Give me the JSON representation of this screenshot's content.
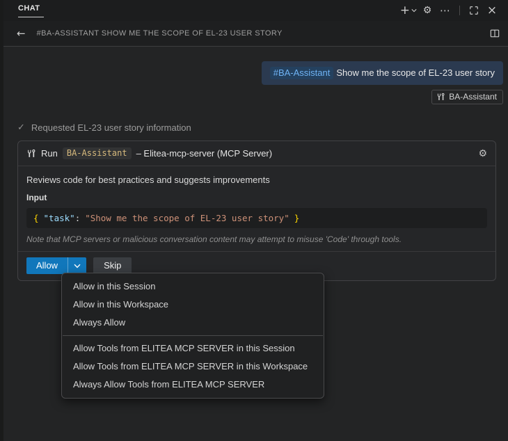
{
  "icons": {
    "plus": "+",
    "gear": "⚙",
    "more": "⋯",
    "close": "×",
    "back": "←",
    "check": "✓"
  },
  "titlebar": {
    "tab_label": "CHAT"
  },
  "breadcrumb": {
    "title": "#BA-ASSISTANT SHOW ME THE SCOPE OF EL-23 USER STORY"
  },
  "chat": {
    "user_message": {
      "mention": "#BA-Assistant",
      "text": "Show me the scope of EL-23 user story"
    },
    "agent_badge": {
      "label": "BA-Assistant"
    },
    "status": {
      "text": "Requested EL-23 user story information"
    }
  },
  "tool_card": {
    "header": {
      "run_label": "Run",
      "tool_name": "BA-Assistant",
      "server_label": "– Elitea-mcp-server (MCP Server)"
    },
    "description": "Reviews code for best practices and suggests improvements",
    "input_label": "Input",
    "code": {
      "open_brace": "{",
      "key": "\"task\"",
      "colon": ":",
      "value": "\"Show me the scope of EL-23 user story\"",
      "close_brace": "}"
    },
    "note": "Note that MCP servers or malicious conversation content may attempt to misuse 'Code' through tools.",
    "actions": {
      "allow": "Allow",
      "skip": "Skip"
    }
  },
  "dropdown": {
    "groups": [
      [
        "Allow in this Session",
        "Allow in this Workspace",
        "Always Allow"
      ],
      [
        "Allow Tools from ELITEA MCP SERVER in this Session",
        "Allow Tools from ELITEA MCP SERVER in this Workspace",
        "Always Allow Tools from ELITEA MCP SERVER"
      ]
    ]
  },
  "colors": {
    "accent_blue": "#1177bb",
    "mention_blue": "#6fb3f5",
    "code_gold": "#ffd700",
    "code_key_blue": "#9cdcfe",
    "code_string_orange": "#ce9178"
  }
}
